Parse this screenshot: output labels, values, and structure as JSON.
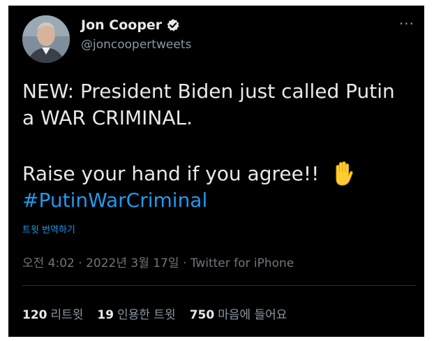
{
  "author": {
    "display_name": "Jon Cooper",
    "handle": "@joncoopertweets"
  },
  "more_label": "···",
  "tweet": {
    "line1": "NEW: President Biden just called Putin",
    "line2": "a WAR CRIMINAL.",
    "line3": "Raise your hand if you agree!!",
    "hashtag": "#PutinWarCriminal"
  },
  "translate_label": "트윗 번역하기",
  "meta": {
    "time": "오전 4:02",
    "date": "2022년 3월 17일",
    "source": "Twitter for iPhone"
  },
  "stats": [
    {
      "count": "120",
      "label": "리트윗"
    },
    {
      "count": "19",
      "label": "인용한 트윗"
    },
    {
      "count": "750",
      "label": "마음에 들어요"
    }
  ],
  "colors": {
    "background": "#000000",
    "link": "#1d9bf0",
    "muted": "#71767b"
  }
}
